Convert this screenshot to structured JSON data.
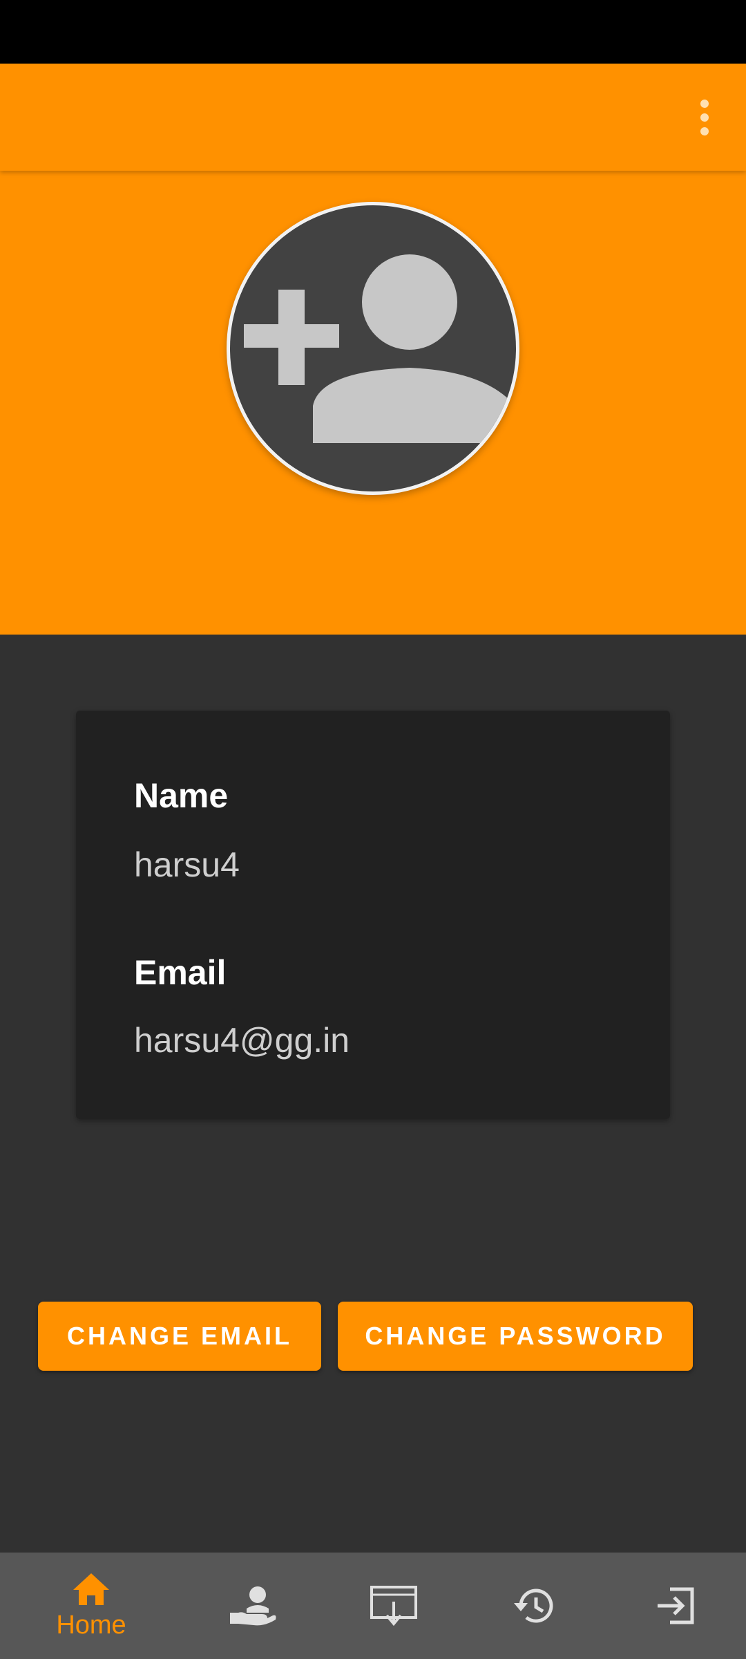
{
  "app_bar": {
    "menu_icon": "more-vert-icon"
  },
  "avatar": {
    "icon": "add-person-icon"
  },
  "profile": {
    "name_label": "Name",
    "name_value": "harsu4",
    "email_label": "Email",
    "email_value": "harsu4@gg.in"
  },
  "actions": {
    "change_email": "CHANGE EMAIL",
    "change_password": "CHANGE PASSWORD"
  },
  "bottom_nav": {
    "items": [
      {
        "icon": "home-icon",
        "label": "Home",
        "active": true
      },
      {
        "icon": "hand-person-icon",
        "label": "",
        "active": false
      },
      {
        "icon": "inbox-download-icon",
        "label": "",
        "active": false
      },
      {
        "icon": "history-icon",
        "label": "",
        "active": false
      },
      {
        "icon": "logout-icon",
        "label": "",
        "active": false
      }
    ]
  },
  "colors": {
    "accent": "#FF9100",
    "background": "#313131",
    "card": "#212121",
    "nav_background": "#575757",
    "icon_inactive": "#E0E0E0"
  }
}
